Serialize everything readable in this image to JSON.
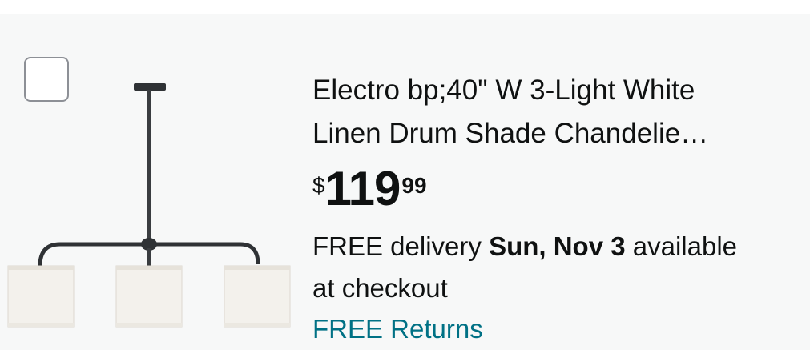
{
  "product": {
    "title_line1": "Electro bp;40\" W 3-Light White",
    "title_line2": "Linen Drum Shade Chandelie…",
    "price": {
      "symbol": "$",
      "whole": "119",
      "fraction": "99"
    },
    "delivery": {
      "prefix": "FREE delivery ",
      "date": "Sun, Nov 3",
      "suffix_line1": " available",
      "suffix_line2": "at checkout"
    },
    "returns_label": "FREE Returns",
    "image_icon": "chandelier-image",
    "checkbox_checked": false
  },
  "colors": {
    "card_bg": "#f7f8f8",
    "text": "#0f1111",
    "link": "#007185"
  }
}
